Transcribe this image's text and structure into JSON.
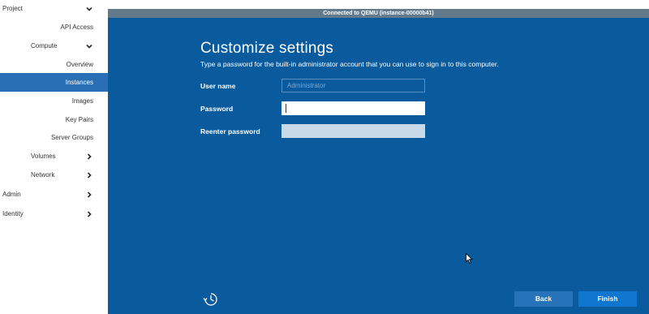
{
  "sidebar": {
    "items": [
      {
        "label": "Project",
        "level": 0,
        "chevron": "down"
      },
      {
        "label": "API Access",
        "level": 2
      },
      {
        "label": "Compute",
        "level": 1,
        "chevron": "down"
      },
      {
        "label": "Overview",
        "level": 2
      },
      {
        "label": "Instances",
        "level": 2,
        "selected": true
      },
      {
        "label": "Images",
        "level": 2
      },
      {
        "label": "Key Pairs",
        "level": 2
      },
      {
        "label": "Server Groups",
        "level": 2
      },
      {
        "label": "Volumes",
        "level": 1,
        "chevron": "right"
      },
      {
        "label": "Network",
        "level": 1,
        "chevron": "right"
      },
      {
        "label": "Admin",
        "level": 0,
        "chevron": "right"
      },
      {
        "label": "Identity",
        "level": 0,
        "chevron": "right"
      }
    ]
  },
  "console": {
    "status": "Connected to QEMU (instance-00000b41)"
  },
  "setup": {
    "title": "Customize settings",
    "description": "Type a password for the built-in administrator account that you can use to sign in to this computer.",
    "username_label": "User name",
    "username_placeholder": "Administrator",
    "password_label": "Password",
    "password_value": "",
    "reenter_label": "Reenter password",
    "reenter_value": "",
    "back_label": "Back",
    "finish_label": "Finish"
  },
  "icons": {
    "ease_of_access": "ease-of-access-icon",
    "cursor": "mouse-pointer-icon"
  },
  "colors": {
    "oobe_background": "#0a5a9e",
    "sidebar_selected": "#2a6fb6",
    "status_bar": "#637a8c",
    "finish_button": "#1077d0",
    "back_button": "#2673b9"
  }
}
